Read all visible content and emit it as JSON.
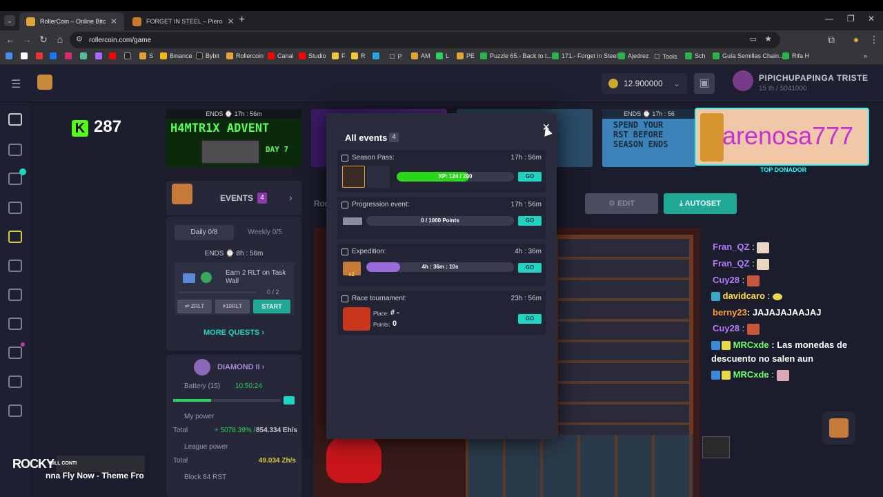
{
  "browser": {
    "tabs": [
      {
        "title": "RollerCoin – Online Bitcoin Mi"
      },
      {
        "title": "FORGET IN STEEL – Piero"
      }
    ],
    "url": "rollercoin.com/game",
    "bookmarks": [
      "S",
      "Binance",
      "Bybit",
      "Rollercoin",
      "Canal",
      "Studio",
      "F",
      "R",
      "P",
      "AM",
      "L",
      "PE",
      "Puzzle 65.- Back to t...",
      "171.- Forget in Steel",
      "Ajedrez",
      "Tools",
      "Sch",
      "Guía Semillas Chain...",
      "Rifa H"
    ]
  },
  "header": {
    "balance": "12.900000",
    "username": "PIPICHUPAPINGA TRISTE",
    "rank": "15 th / 5041000"
  },
  "stream": {
    "kick_count": "287",
    "donor_name": "arenosa777",
    "donor_label": "TOP DONADOR",
    "music_artist": "BILL CONTI",
    "music_title": "nna Fly Now - Theme Fro",
    "music_logo": "ROCKY"
  },
  "banners": [
    {
      "ends": "ENDS ⌚ 17h : 56m",
      "title": "H4MTR1X ADVENT",
      "sub": "DAY 7"
    },
    {
      "ends": "ENDS ⌚ 17h : 56",
      "title": "SPEND YOUR RST BEFORE SEASON ENDS"
    }
  ],
  "left_panel": {
    "events_label": "EVENTS",
    "events_count": "4",
    "tab_daily": "Daily 0/8",
    "tab_weekly": "Weekly 0/5",
    "ends": "ENDS ⌚ 8h : 56m",
    "task_text": "Earn 2 RLT on Task Wall",
    "task_progress": "0 / 2",
    "btn_1": "⇄ 2RLT",
    "btn_2": "⏵10RLT",
    "btn_start": "START",
    "more_quests": "MORE QUESTS",
    "league": "DIAMOND II",
    "battery_label": "Battery (15)",
    "battery_time": "10:50:24",
    "my_power_label": "My power",
    "total_label": "Total",
    "my_power_pct": "+ 5078.39% /",
    "my_power_value": "854.334 Eh/s",
    "league_power_label": "League power",
    "league_total": "49.034 Zh/s",
    "block_label": "Block 84 RST"
  },
  "room": {
    "edit_label": "EDIT",
    "autoset_label": "AUTOSET",
    "tab_partial": "Roo"
  },
  "modal": {
    "title": "All events",
    "count": "4",
    "events": [
      {
        "name": "Season Pass:",
        "time": "17h : 56m",
        "bar_text": "XP: 124 / 200",
        "progress": 0.62,
        "go": "GO"
      },
      {
        "name": "Progression event:",
        "time": "17h : 56m",
        "bar_text": "0 / 1000 Points",
        "progress": 0.0,
        "go": "GO"
      },
      {
        "name": "Expedition:",
        "time": "4h : 36m",
        "bar_text": "4h : 36m : 10s",
        "progress": 0.23,
        "go": "GO",
        "badge": "x2"
      },
      {
        "name": "Race tournament:",
        "time": "23h : 56m",
        "place_label": "Place:",
        "place_value": "# -",
        "points_label": "Points:",
        "points_value": "0",
        "go": "GO"
      }
    ]
  },
  "chat": [
    {
      "name": "Fran_QZ",
      "msg": ":",
      "color": "#b57bff"
    },
    {
      "name": "Fran_QZ",
      "msg": ":",
      "color": "#b57bff"
    },
    {
      "name": "Cuy28",
      "msg": ":",
      "color": "#b57bff"
    },
    {
      "name": "davidcaro",
      "msg": ":",
      "color": "#ffe033"
    },
    {
      "name": "berny23",
      "msg": ": JAJAJAJAAJAJ",
      "color": "#ff9f2e"
    },
    {
      "name": "Cuy28",
      "msg": ":",
      "color": "#b57bff"
    },
    {
      "name": "MRCxde",
      "msg": ": Las monedas de",
      "msg2": "descuento no salen aun",
      "color": "#69ff69"
    },
    {
      "name": "MRCxde",
      "msg": ":",
      "color": "#69ff69"
    }
  ]
}
